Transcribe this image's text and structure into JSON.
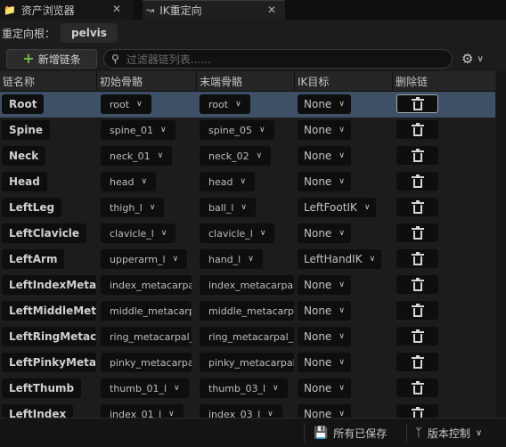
{
  "tabs": [
    {
      "label": "资产浏览器",
      "icon": "folder-icon"
    },
    {
      "label": "IK重定向",
      "icon": "ik-retarget-icon"
    }
  ],
  "root": {
    "label": "重定向根：",
    "value": "pelvis"
  },
  "toolbar": {
    "add_label": "新增链条",
    "search_placeholder": "过滤器链列表......"
  },
  "columns": [
    "链名称",
    "初始骨骼",
    "末端骨骼",
    "IK目标",
    "删除链"
  ],
  "rows": [
    {
      "name": "Root",
      "start": "root",
      "end": "root",
      "ik": "None",
      "selected": true
    },
    {
      "name": "Spine",
      "start": "spine_01",
      "end": "spine_05",
      "ik": "None"
    },
    {
      "name": "Neck",
      "start": "neck_01",
      "end": "neck_02",
      "ik": "None"
    },
    {
      "name": "Head",
      "start": "head",
      "end": "head",
      "ik": "None"
    },
    {
      "name": "LeftLeg",
      "start": "thigh_l",
      "end": "ball_l",
      "ik": "LeftFootIK"
    },
    {
      "name": "LeftClavicle",
      "start": "clavicle_l",
      "end": "clavicle_l",
      "ik": "None"
    },
    {
      "name": "LeftArm",
      "start": "upperarm_l",
      "end": "hand_l",
      "ik": "LeftHandIK"
    },
    {
      "name": "LeftIndexMetaca",
      "start": "index_metacarpal_l",
      "end": "index_metacarpal_l",
      "ik": "None"
    },
    {
      "name": "LeftMiddleMetac",
      "start": "middle_metacarpal",
      "end": "middle_metacarpal",
      "ik": "None"
    },
    {
      "name": "LeftRingMetacar",
      "start": "ring_metacarpal_l",
      "end": "ring_metacarpal_l",
      "ik": "None"
    },
    {
      "name": "LeftPinkyMetaca",
      "start": "pinky_metacarpal_l",
      "end": "pinky_metacarpal_l",
      "ik": "None"
    },
    {
      "name": "LeftThumb",
      "start": "thumb_01_l",
      "end": "thumb_03_l",
      "ik": "None"
    },
    {
      "name": "LeftIndex",
      "start": "index_01_l",
      "end": "index_03_l",
      "ik": "None"
    }
  ],
  "statusbar": {
    "save_all": "所有已保存",
    "source_control": "版本控制"
  },
  "colors": {
    "accent_plus": "#6ec24a",
    "selected_row": "#3d5066"
  }
}
